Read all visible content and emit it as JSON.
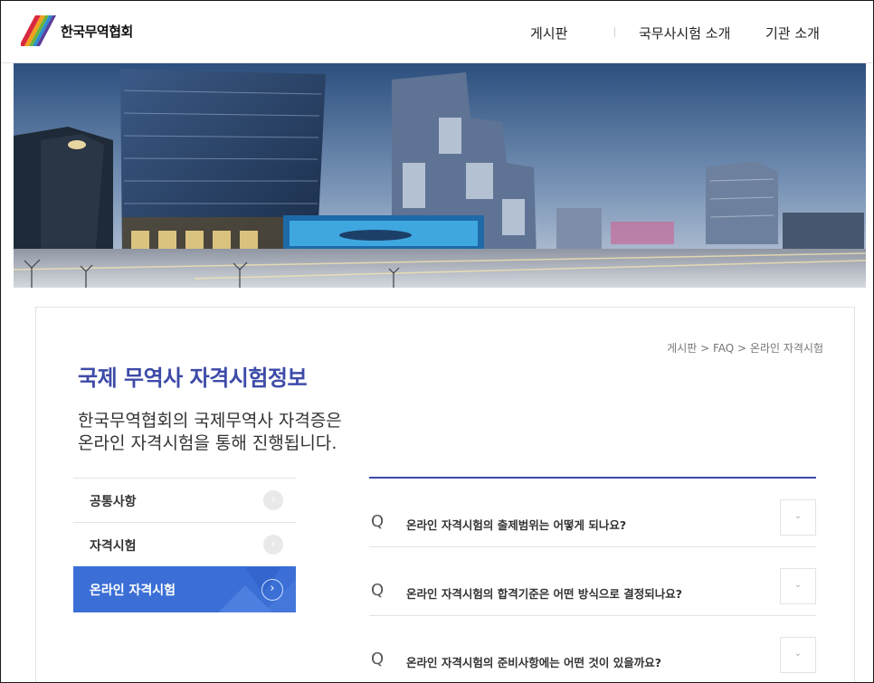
{
  "header": {
    "logo_text": "한국무역협회",
    "nav": [
      "게시판",
      "국무사시험 소개",
      "기관 소개"
    ]
  },
  "hero": {
    "alt": "city skyline"
  },
  "breadcrumb": "게시판 > FAQ > 온라인 자격시험",
  "page": {
    "title": "국제 무역사 자격시험정보",
    "desc_line1": "한국무역협회의 국제무역사 자격증은",
    "desc_line2": "온라인 자격시험을 통해 진행됩니다."
  },
  "sidebar": {
    "items": [
      {
        "label": "공통사항",
        "active": false
      },
      {
        "label": "자격시험",
        "active": false
      },
      {
        "label": "온라인 자격시험",
        "active": true
      }
    ]
  },
  "faq": {
    "marker": "Q",
    "items": [
      "온라인 자격시험의 출제범위는 어떻게 되나요?",
      "온라인 자격시험의 합격기준은 어떤 방식으로 결정되나요?",
      "온라인 자격시험의 준비사항에는 어떤 것이 있을까요?"
    ]
  },
  "colors": {
    "accent": "#3d4ba8",
    "active": "#3b6fd6"
  }
}
